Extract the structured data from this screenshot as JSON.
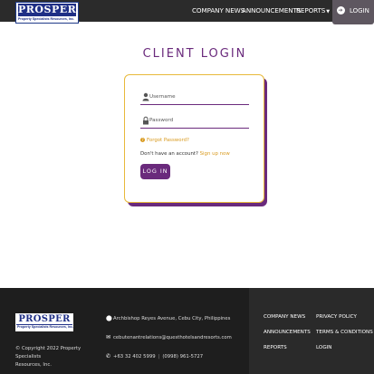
{
  "header": {
    "logo_word": "PROSPER",
    "logo_sub": "Property Specialists Resources, Inc.",
    "nav": [
      {
        "label": "COMPANY NEWS"
      },
      {
        "label": "ANNOUNCEMENTS"
      },
      {
        "label": "REPORTS"
      }
    ],
    "login_label": "LOGIN"
  },
  "page": {
    "title": "CLIENT LOGIN"
  },
  "form": {
    "username_placeholder": "Username",
    "password_placeholder": "Password",
    "forgot_label": "Forgot Password?",
    "no_account_text": "Don't have an account?",
    "signup_label": "Sign up now",
    "submit_label": "LOG IN"
  },
  "footer": {
    "logo_word": "PROSPER",
    "logo_sub": "Property Specialists Resources, Inc.",
    "copyright_line1": "© Copyright 2022 Property Specialists",
    "copyright_line2": "Resources, Inc.",
    "address": "Archbishop Reyes Avenue, Cebu City, Philippines",
    "email": "cebutenantrelations@questhotelsandresorts.com",
    "phone1": "+63 32 402 5999",
    "phone2": "(0998) 961-5727",
    "links_col1": [
      "COMPANY NEWS",
      "ANNOUNCEMENTS",
      "REPORTS"
    ],
    "links_col2": [
      "PRIVACY POLICY",
      "TERMS & CONDITIONS",
      "LOGIN"
    ]
  },
  "colors": {
    "brand_purple": "#6a2a7c",
    "accent_gold": "#d99a1f",
    "navbar_bg": "#2b2b2b",
    "footer_bg": "#1e1e1e"
  }
}
